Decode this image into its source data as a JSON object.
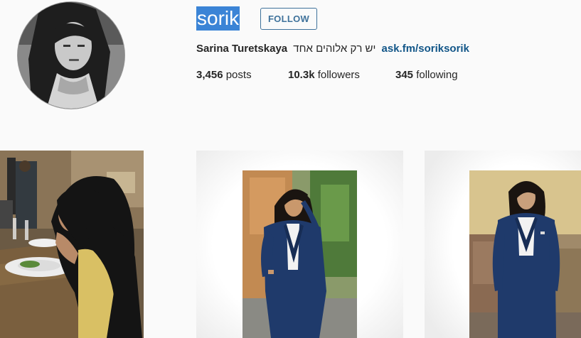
{
  "profile": {
    "username": "sorik",
    "follow_label": "FOLLOW",
    "full_name": "Sarina Turetskaya",
    "bio_text": "יש רק אלוהים אחד",
    "link": "ask.fm/soriksorik",
    "stats": {
      "posts_count": "3,456",
      "posts_label": "posts",
      "followers_count": "10.3k",
      "followers_label": "followers",
      "following_count": "345",
      "following_label": "following"
    }
  },
  "posts": [
    {
      "description": "girl at restaurant table"
    },
    {
      "description": "girl in navy suit outdoors"
    },
    {
      "description": "girl in navy suit by building"
    }
  ],
  "colors": {
    "username_highlight": "#3b84d6",
    "follow_border": "#3f729b",
    "link": "#125688",
    "suit_navy": "#1f3a6b"
  }
}
